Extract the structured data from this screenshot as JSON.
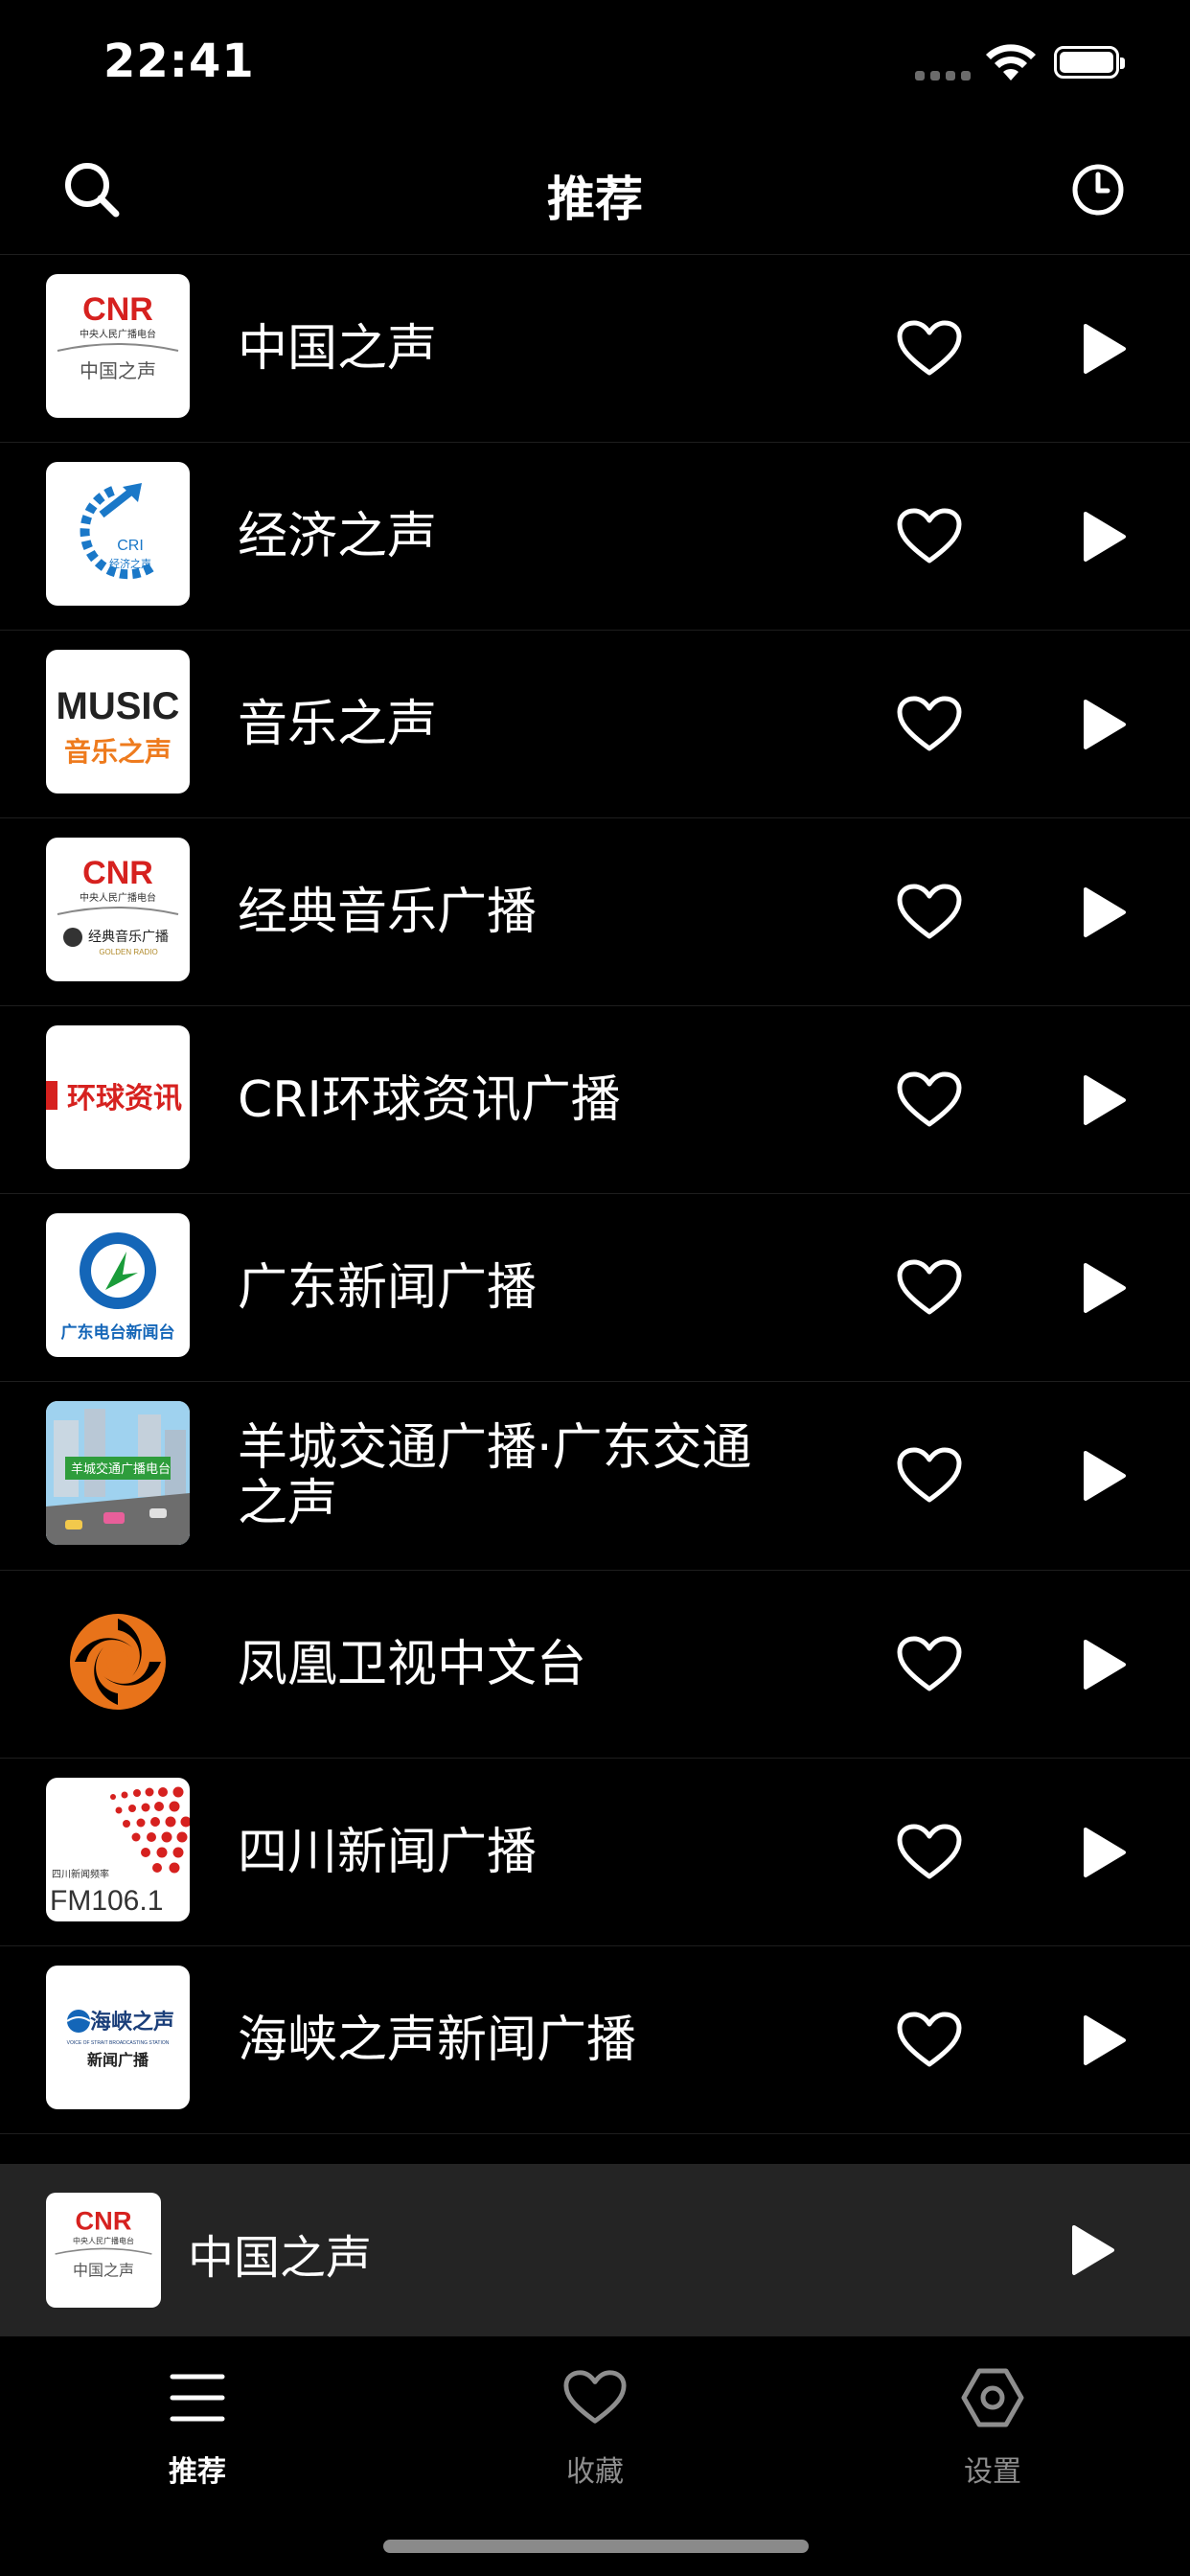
{
  "status_bar": {
    "time": "22:41"
  },
  "nav": {
    "title": "推荐"
  },
  "stations": [
    {
      "name": "中国之声",
      "logo": "cnr-voice-of-china-logo"
    },
    {
      "name": "经济之声",
      "logo": "cnr-economy-logo"
    },
    {
      "name": "音乐之声",
      "logo": "music-radio-logo"
    },
    {
      "name": "经典音乐广播",
      "logo": "cnr-classic-music-logo"
    },
    {
      "name": "CRI环球资讯广播",
      "logo": "cri-global-news-logo"
    },
    {
      "name": "广东新闻广播",
      "logo": "guangdong-news-logo"
    },
    {
      "name": "羊城交通广播·广东交通之声",
      "logo": "guangzhou-traffic-logo"
    },
    {
      "name": "凤凰卫视中文台",
      "logo": "phoenix-tv-logo"
    },
    {
      "name": "四川新闻广播",
      "logo": "sichuan-news-logo"
    },
    {
      "name": "海峡之声新闻广播",
      "logo": "voice-of-strait-logo"
    }
  ],
  "mini_player": {
    "title": "中国之声"
  },
  "tabs": [
    {
      "label": "推荐",
      "active": true
    },
    {
      "label": "收藏",
      "active": false
    },
    {
      "label": "设置",
      "active": false
    }
  ],
  "logo_text": {
    "cnr": "CNR",
    "cnr_sub": "中央人民广播电台",
    "zgzs": "中国之声",
    "cri": "CRI",
    "jjzs": "经济之声",
    "music": "MUSIC",
    "ylzs": "音乐之声",
    "jdyl": "经典音乐广播",
    "golden": "GOLDEN RADIO",
    "hqzx": "环球资讯",
    "gddt": "广东电台新闻台",
    "ycjt": "羊城交通广播电台",
    "sc_sub": "四川新闻频率",
    "fm": "FM106.1",
    "hxzs": "海峡之声",
    "hxzs_en": "VOICE OF STRAIT BROADCASTING STATION",
    "xwgb": "新闻广播"
  },
  "colors": {
    "accent": "#ffffff",
    "cnr_red": "#d6211f",
    "cri_blue": "#1a78c8",
    "phoenix_orange": "#e8731a"
  }
}
